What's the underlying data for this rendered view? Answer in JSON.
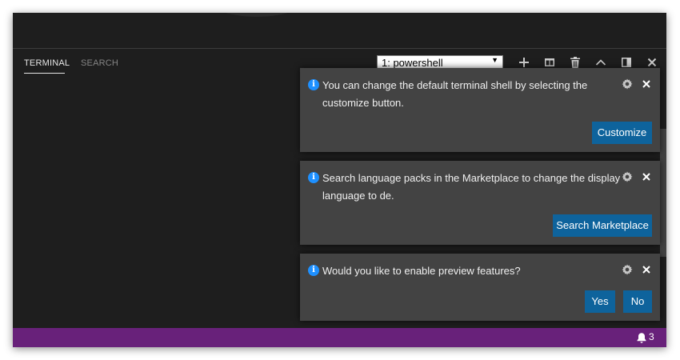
{
  "panel": {
    "tabs": [
      {
        "label": "TERMINAL",
        "active": true
      },
      {
        "label": "SEARCH",
        "active": false
      }
    ],
    "shell_select": {
      "value": "1: powershell"
    },
    "toolbar_icons": [
      "plus-icon",
      "split-icon",
      "trash-icon",
      "chevron-up-icon",
      "maximize-panel-icon",
      "close-icon"
    ]
  },
  "notifications": [
    {
      "message": "You can change the default terminal shell by selecting the customize button.",
      "buttons": [
        "Customize"
      ]
    },
    {
      "message": "Search language packs in the Marketplace to change the display language to de.",
      "buttons": [
        "Search Marketplace"
      ]
    },
    {
      "message": "Would you like to enable preview features?",
      "buttons": [
        "Yes",
        "No"
      ]
    }
  ],
  "statusbar": {
    "notification_count": "3",
    "color": "#68217a"
  },
  "colors": {
    "button": "#0e639c",
    "toast_background": "#434343",
    "info_icon": "#1e90ff"
  }
}
